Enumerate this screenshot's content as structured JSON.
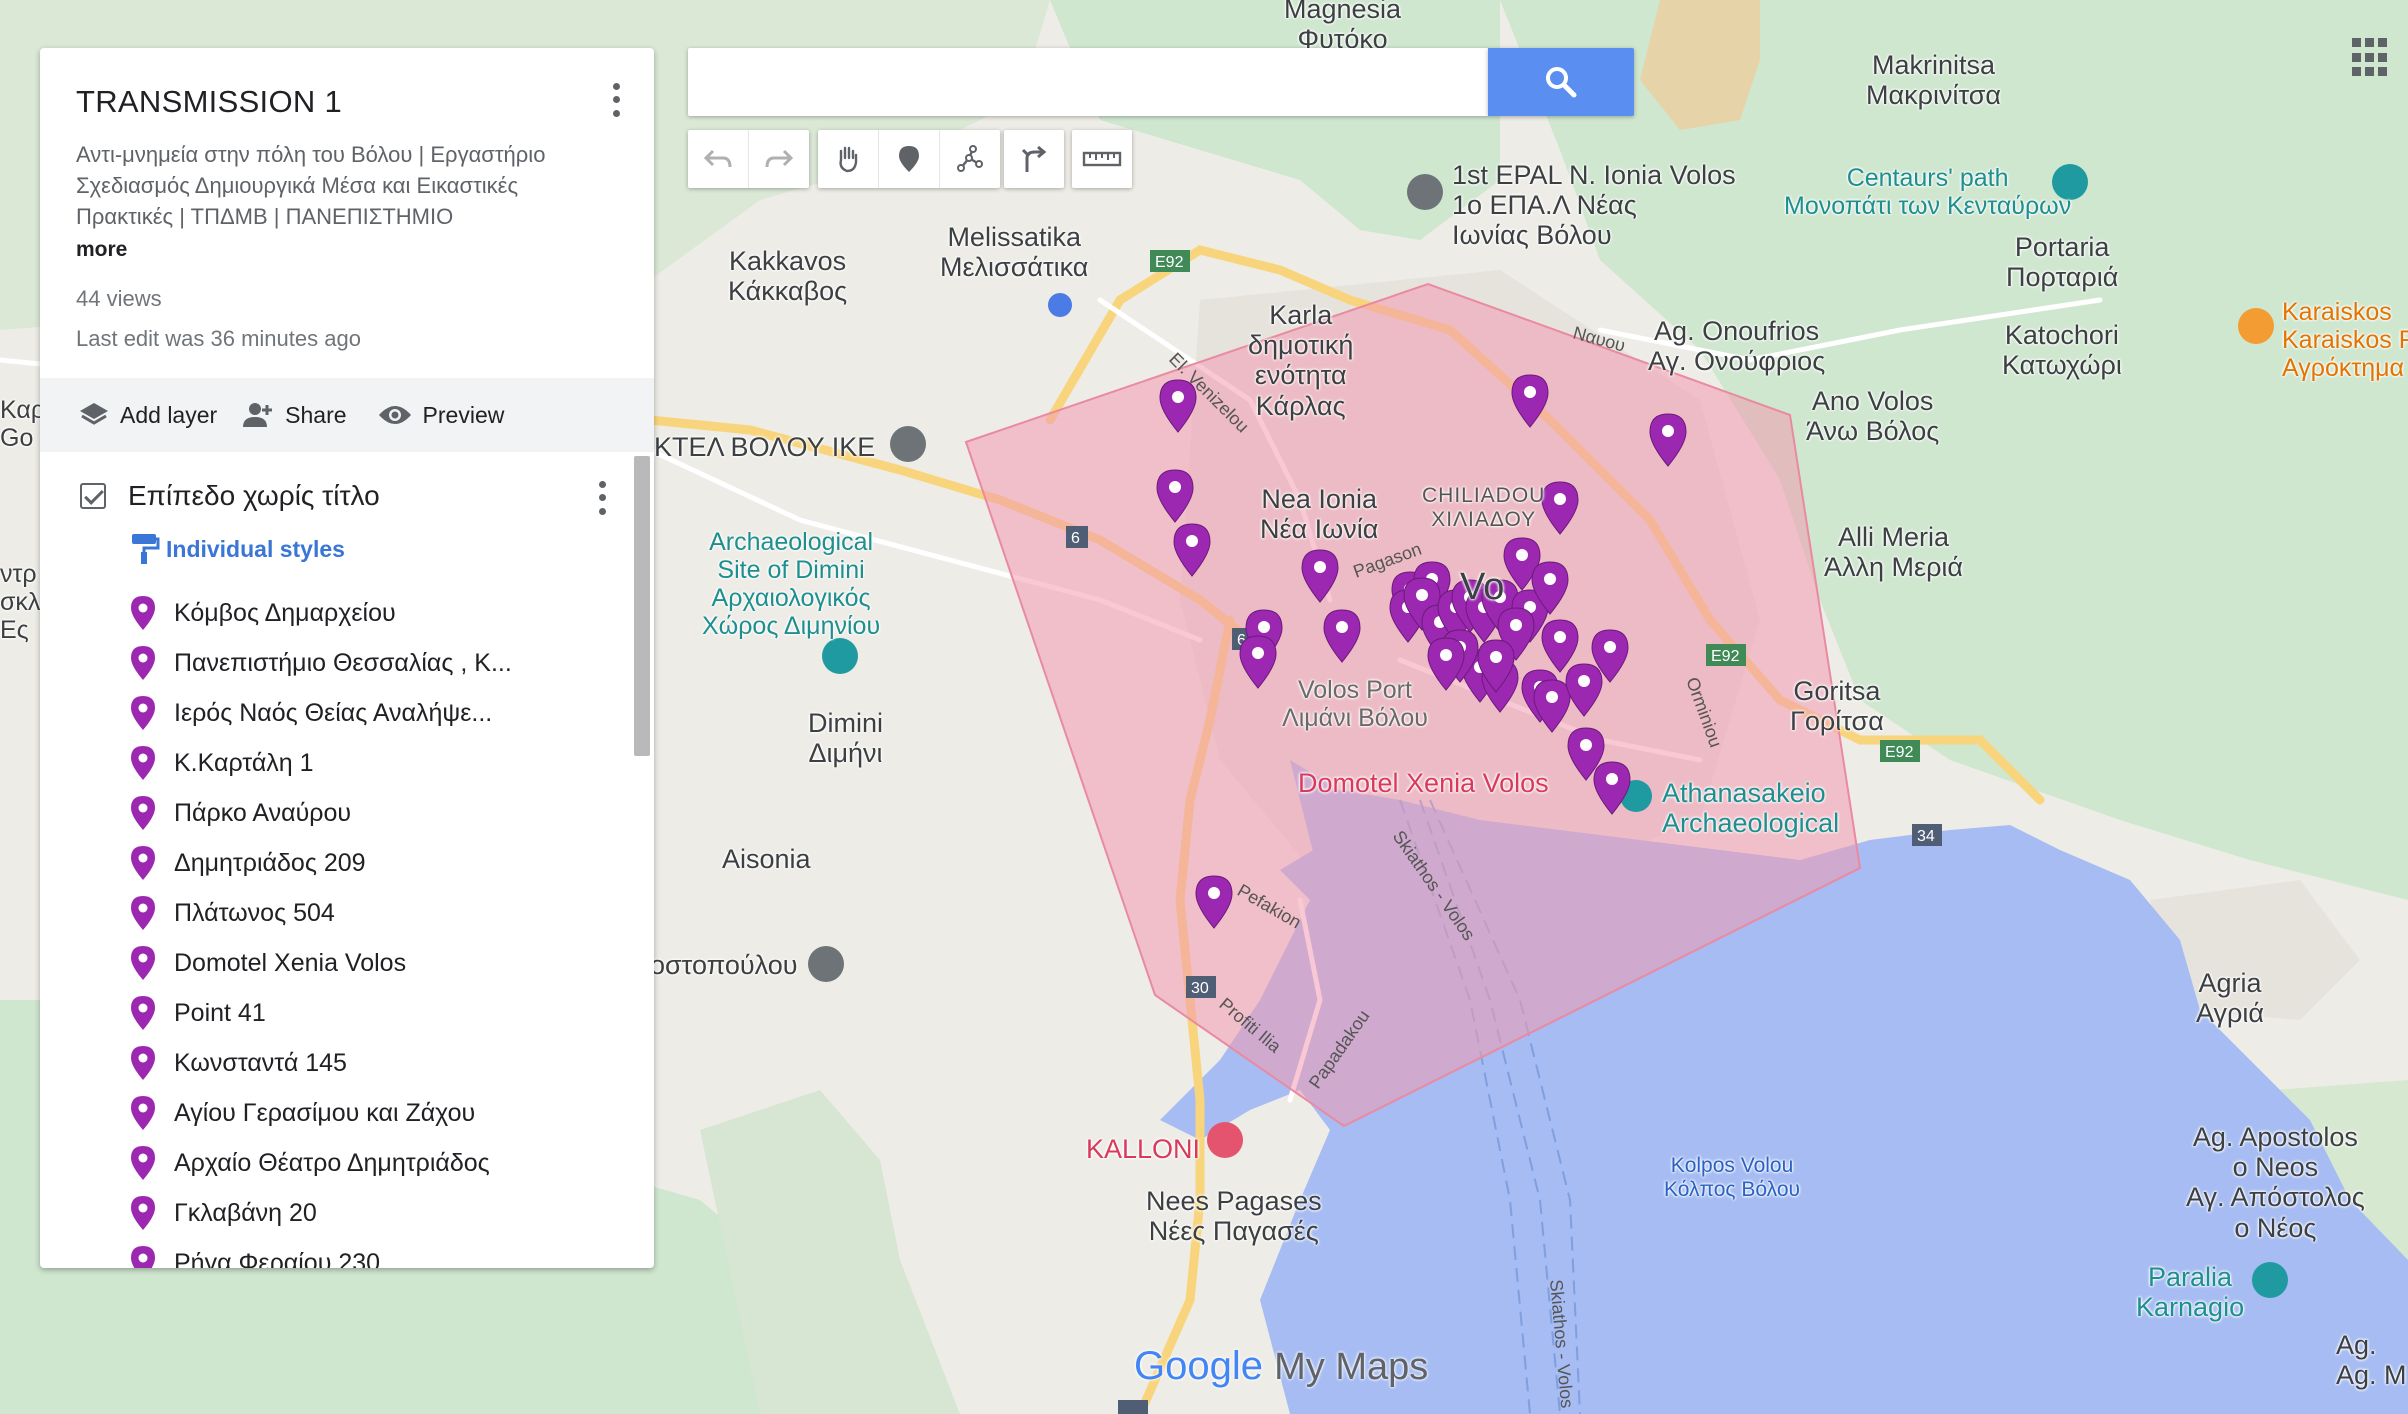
{
  "search": {
    "placeholder": "",
    "value": "",
    "icon": "search-icon"
  },
  "panel": {
    "title": "TRANSMISSION 1",
    "description": "Αντι-μνημεία στην πόλη του Βόλου | Εργαστήριο Σχεδιασμός Δημιουργικά Μέσα και Εικαστικές Πρακτικές | ΤΠΔΜΒ | ΠΑΝΕΠΙΣΤΗΜΙΟ",
    "more": "more",
    "views": "44 views",
    "last_edit": "Last edit was 36 minutes ago",
    "actions": {
      "add_layer": "Add layer",
      "share": "Share",
      "preview": "Preview"
    },
    "layer": {
      "title": "Επίπεδο χωρίς τίτλο",
      "styles": "Individual styles",
      "places": [
        "Κόμβος Δημαρχείου",
        "Πανεπιστήμιο Θεσσαλίας , Κ...",
        "Ιερός Ναός Θείας Αναλήψε...",
        "Κ.Καρτάλη 1",
        "Πάρκο Αναύρου",
        "Δημητριάδος 209",
        "Πλάτωνος 504",
        "Domotel Xenia Volos",
        "Point 41",
        "Κωνσταντά 145",
        "Αγίου Γερασίμου και Ζάχου",
        "Αρχαίο Θέατρο Δημητριάδος",
        "Γκλαβάνη 20",
        "Ρήγα Φεραίου 230"
      ]
    }
  },
  "map": {
    "labels": {
      "magnesia": "Magnesia\nΦυτόκο",
      "makrinitsa": "Makrinitsa\nΜακρινίτσα",
      "epal": "1st EPAL N. Ionia Volos\n1ο ΕΠΑ.Λ Νέας\nΙωνίας Βόλου",
      "centaurs": "Centaurs' path\nΜονοπάτι των Κενταύρων",
      "portaria": "Portaria\nΠορταριά",
      "karaiskos": "Karaiskos\nKaraiskos Fa\nΑγρόκτημα Κ",
      "kakkavos": "Kakkavos\nΚάκκαβος",
      "melissatika": "Melissatika\nΜελισσάτικα",
      "karla": "Karla\nδημοτική\nενότητα\nΚάρλας",
      "onoufrios": "Ag. Onoufrios\nΑγ. Ονούφριος",
      "katochori": "Katochori\nΚατωχώρι",
      "ano_volos": "Ano Volos\nΆνω Βόλος",
      "ktel": "ΚΤΕΛ ΒΟΛΟΥ ΙΚΕ",
      "nea_ionia": "Nea Ionia\nΝέα Ιωνία",
      "chiliadou": "CHILIADOU\nΧΙΛΙΑΔΟΥ",
      "volos": "Vo",
      "dimini_site": "Archaeological\nSite of Dimini\nΑρχαιολογικός\nΧώρος Διμηνίου",
      "alli_meria": "Alli Meria\nΆλλη Μεριά",
      "dimini": "Dimini\nΔιμήνι",
      "volos_port": "Volos Port\nΛιμάνι Βόλου",
      "goritsa": "Goritsa\nΓορίτσα",
      "xenia": "Domotel Xenia Volos",
      "athanasakeio": "Athanasakeio\nArchaeological",
      "aisonia": "Aisonia",
      "stopoulou": "οστοπούλου",
      "agria": "Agria\nΑγριά",
      "kalloni": "KALLONI",
      "nees_pagases": "Nees Pagases\nΝέες Παγασές",
      "kolpos": "Kolpos Volou\nΚόλπος Βόλου",
      "apostolos": "Ag. Apostolos\nο Neos\nΑγ. Απόστολος\nο Νέος",
      "paralia": "Paralia\nKarnagio",
      "ag_m": "Ag.\nAg. M",
      "kar": "Καρ\nGo",
      "left_edge": "ντρ\nσκλ\nΕς"
    },
    "roads": [
      "E92",
      "E92",
      "E92",
      "6",
      "6",
      "30",
      "34",
      "30",
      "Pagason",
      "Orminiou",
      "Skiathos - Volos",
      "Skiathos - Volos",
      "Pefakion",
      "Profiti Ilia",
      "Papadakou",
      "Ναυου",
      "El. Venizelou"
    ],
    "colors": {
      "pin": "#9c27b0",
      "polygon_fill": "#f29bb1",
      "polygon_stroke": "#e98aa0",
      "water": "#a6bcf2",
      "accent": "#5b8ef1"
    }
  },
  "logo": {
    "google": "Google",
    "mymaps": "My Maps"
  }
}
